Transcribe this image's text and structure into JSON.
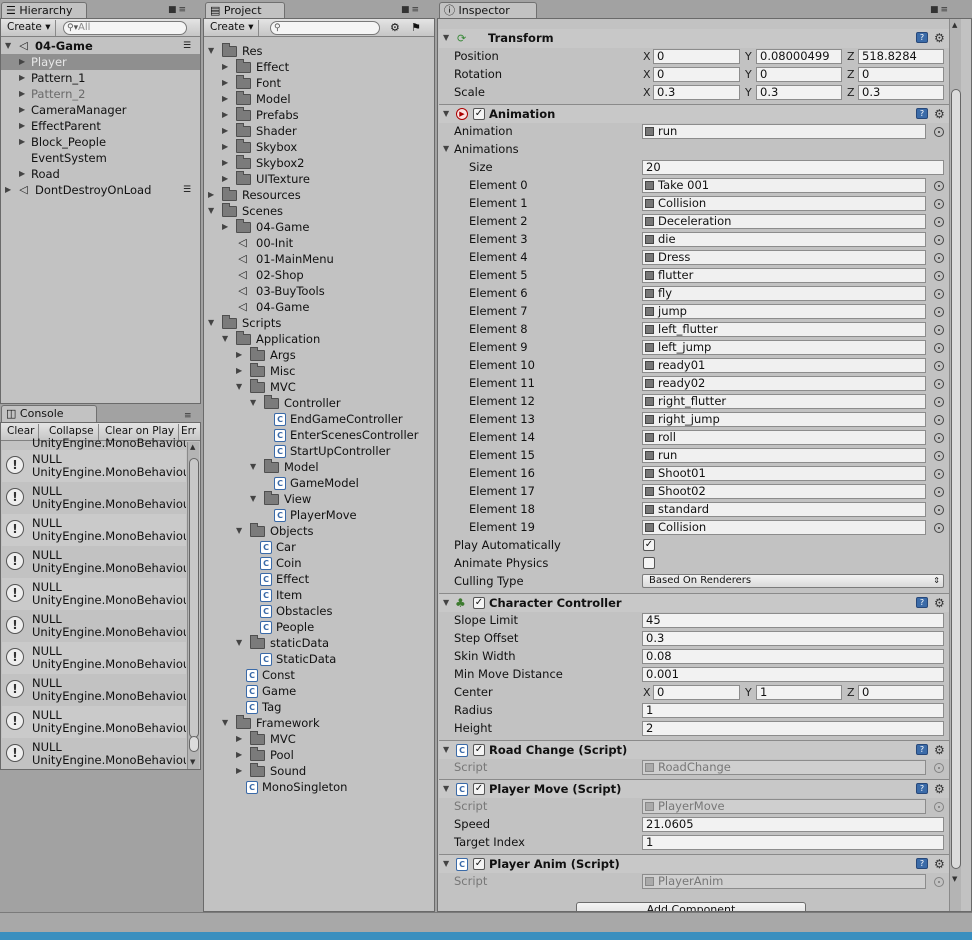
{
  "hierarchy": {
    "tab": "Hierarchy",
    "create": "Create",
    "search_placeholder": "All",
    "items": [
      {
        "label": "04-Game",
        "bold": true,
        "arrow": "▼",
        "scene": true
      },
      {
        "label": "Player",
        "selected": true,
        "arrow": "▶"
      },
      {
        "label": "Pattern_1",
        "arrow": "▶"
      },
      {
        "label": "Pattern_2",
        "dim": true,
        "arrow": "▶"
      },
      {
        "label": "CameraManager",
        "arrow": "▶"
      },
      {
        "label": "EffectParent",
        "arrow": "▶"
      },
      {
        "label": "Block_People",
        "arrow": "▶"
      },
      {
        "label": "EventSystem",
        "arrow": ""
      },
      {
        "label": "Road",
        "arrow": "▶"
      },
      {
        "label": "DontDestroyOnLoad",
        "arrow": "▶",
        "scene": true
      }
    ]
  },
  "console": {
    "tab": "Console",
    "buttons": [
      "Clear",
      "Collapse",
      "Clear on Play",
      "Err"
    ],
    "partial_line": "UnityEngine.MonoBehaviou",
    "entries": [
      {
        "line1": "NULL",
        "line2": "UnityEngine.MonoBehaviou"
      },
      {
        "line1": "NULL",
        "line2": "UnityEngine.MonoBehaviou"
      },
      {
        "line1": "NULL",
        "line2": "UnityEngine.MonoBehaviou"
      },
      {
        "line1": "NULL",
        "line2": "UnityEngine.MonoBehaviou"
      },
      {
        "line1": "NULL",
        "line2": "UnityEngine.MonoBehaviou"
      },
      {
        "line1": "NULL",
        "line2": "UnityEngine.MonoBehaviou"
      },
      {
        "line1": "NULL",
        "line2": "UnityEngine.MonoBehaviou"
      },
      {
        "line1": "NULL",
        "line2": "UnityEngine.MonoBehaviou"
      },
      {
        "line1": "NULL",
        "line2": "UnityEngine.MonoBehaviou"
      },
      {
        "line1": "NULL",
        "line2": "UnityEngine.MonoBehaviou"
      }
    ]
  },
  "project": {
    "tab": "Project",
    "create": "Create",
    "tree": [
      {
        "label": "Res",
        "depth": 0,
        "type": "folder",
        "open": true
      },
      {
        "label": "Effect",
        "depth": 1,
        "type": "folder"
      },
      {
        "label": "Font",
        "depth": 1,
        "type": "folder"
      },
      {
        "label": "Model",
        "depth": 1,
        "type": "folder"
      },
      {
        "label": "Prefabs",
        "depth": 1,
        "type": "folder"
      },
      {
        "label": "Shader",
        "depth": 1,
        "type": "folder"
      },
      {
        "label": "Skybox",
        "depth": 1,
        "type": "folder"
      },
      {
        "label": "Skybox2",
        "depth": 1,
        "type": "folder"
      },
      {
        "label": "UITexture",
        "depth": 1,
        "type": "folder"
      },
      {
        "label": "Resources",
        "depth": 0,
        "type": "folder"
      },
      {
        "label": "Scenes",
        "depth": 0,
        "type": "folder",
        "open": true
      },
      {
        "label": "04-Game",
        "depth": 1,
        "type": "folder"
      },
      {
        "label": "00-Init",
        "depth": 1,
        "type": "scene"
      },
      {
        "label": "01-MainMenu",
        "depth": 1,
        "type": "scene"
      },
      {
        "label": "02-Shop",
        "depth": 1,
        "type": "scene"
      },
      {
        "label": "03-BuyTools",
        "depth": 1,
        "type": "scene"
      },
      {
        "label": "04-Game",
        "depth": 1,
        "type": "scene"
      },
      {
        "label": "Scripts",
        "depth": 0,
        "type": "folder",
        "open": true
      },
      {
        "label": "Application",
        "depth": 1,
        "type": "folder",
        "open": true
      },
      {
        "label": "Args",
        "depth": 2,
        "type": "folder"
      },
      {
        "label": "Misc",
        "depth": 2,
        "type": "folder"
      },
      {
        "label": "MVC",
        "depth": 2,
        "type": "folder",
        "open": true
      },
      {
        "label": "Controller",
        "depth": 3,
        "type": "folder",
        "open": true
      },
      {
        "label": "EndGameController",
        "depth": 4,
        "type": "script"
      },
      {
        "label": "EnterScenesController",
        "depth": 4,
        "type": "script"
      },
      {
        "label": "StartUpController",
        "depth": 4,
        "type": "script"
      },
      {
        "label": "Model",
        "depth": 3,
        "type": "folder",
        "open": true
      },
      {
        "label": "GameModel",
        "depth": 4,
        "type": "script"
      },
      {
        "label": "View",
        "depth": 3,
        "type": "folder",
        "open": true
      },
      {
        "label": "PlayerMove",
        "depth": 4,
        "type": "script"
      },
      {
        "label": "Objects",
        "depth": 2,
        "type": "folder",
        "open": true
      },
      {
        "label": "Car",
        "depth": 3,
        "type": "script"
      },
      {
        "label": "Coin",
        "depth": 3,
        "type": "script"
      },
      {
        "label": "Effect",
        "depth": 3,
        "type": "script"
      },
      {
        "label": "Item",
        "depth": 3,
        "type": "script"
      },
      {
        "label": "Obstacles",
        "depth": 3,
        "type": "script"
      },
      {
        "label": "People",
        "depth": 3,
        "type": "script"
      },
      {
        "label": "staticData",
        "depth": 2,
        "type": "folder",
        "open": true
      },
      {
        "label": "StaticData",
        "depth": 3,
        "type": "script"
      },
      {
        "label": "Const",
        "depth": 2,
        "type": "script"
      },
      {
        "label": "Game",
        "depth": 2,
        "type": "script"
      },
      {
        "label": "Tag",
        "depth": 2,
        "type": "script"
      },
      {
        "label": "Framework",
        "depth": 1,
        "type": "folder",
        "open": true
      },
      {
        "label": "MVC",
        "depth": 2,
        "type": "folder"
      },
      {
        "label": "Pool",
        "depth": 2,
        "type": "folder"
      },
      {
        "label": "Sound",
        "depth": 2,
        "type": "folder"
      },
      {
        "label": "MonoSingleton",
        "depth": 2,
        "type": "script"
      }
    ]
  },
  "inspector": {
    "tab": "Inspector",
    "transform": {
      "title": "Transform",
      "position": {
        "label": "Position",
        "x": "0",
        "y": "0.08000499",
        "z": "518.8284"
      },
      "rotation": {
        "label": "Rotation",
        "x": "0",
        "y": "0",
        "z": "0"
      },
      "scale": {
        "label": "Scale",
        "x": "0.3",
        "y": "0.3",
        "z": "0.3"
      }
    },
    "animation": {
      "title": "Animation",
      "animation_label": "Animation",
      "animation_value": "run",
      "animations_label": "Animations",
      "size_label": "Size",
      "size_value": "20",
      "elements": [
        {
          "label": "Element 0",
          "value": "Take 001"
        },
        {
          "label": "Element 1",
          "value": "Collision"
        },
        {
          "label": "Element 2",
          "value": "Deceleration"
        },
        {
          "label": "Element 3",
          "value": "die"
        },
        {
          "label": "Element 4",
          "value": "Dress"
        },
        {
          "label": "Element 5",
          "value": "flutter"
        },
        {
          "label": "Element 6",
          "value": "fly"
        },
        {
          "label": "Element 7",
          "value": "jump"
        },
        {
          "label": "Element 8",
          "value": "left_flutter"
        },
        {
          "label": "Element 9",
          "value": "left_jump"
        },
        {
          "label": "Element 10",
          "value": "ready01"
        },
        {
          "label": "Element 11",
          "value": "ready02"
        },
        {
          "label": "Element 12",
          "value": "right_flutter"
        },
        {
          "label": "Element 13",
          "value": "right_jump"
        },
        {
          "label": "Element 14",
          "value": "roll"
        },
        {
          "label": "Element 15",
          "value": "run"
        },
        {
          "label": "Element 16",
          "value": "Shoot01"
        },
        {
          "label": "Element 17",
          "value": "Shoot02"
        },
        {
          "label": "Element 18",
          "value": "standard"
        },
        {
          "label": "Element 19",
          "value": "Collision"
        }
      ],
      "play_auto_label": "Play Automatically",
      "play_auto": true,
      "animate_physics_label": "Animate Physics",
      "animate_physics": false,
      "culling_label": "Culling Type",
      "culling_value": "Based On Renderers"
    },
    "character_controller": {
      "title": "Character Controller",
      "slope_label": "Slope Limit",
      "slope": "45",
      "step_label": "Step Offset",
      "step": "0.3",
      "skin_label": "Skin Width",
      "skin": "0.08",
      "minmove_label": "Min Move Distance",
      "minmove": "0.001",
      "center_label": "Center",
      "cx": "0",
      "cy": "1",
      "cz": "0",
      "radius_label": "Radius",
      "radius": "1",
      "height_label": "Height",
      "height": "2"
    },
    "road_change": {
      "title": "Road Change (Script)",
      "script_label": "Script",
      "script": "RoadChange"
    },
    "player_move": {
      "title": "Player Move (Script)",
      "script_label": "Script",
      "script": "PlayerMove",
      "speed_label": "Speed",
      "speed": "21.0605",
      "target_label": "Target Index",
      "target": "1"
    },
    "player_anim": {
      "title": "Player Anim (Script)",
      "script_label": "Script",
      "script": "PlayerAnim"
    },
    "add_component": "Add Component",
    "axis": {
      "x": "X",
      "y": "Y",
      "z": "Z"
    }
  }
}
